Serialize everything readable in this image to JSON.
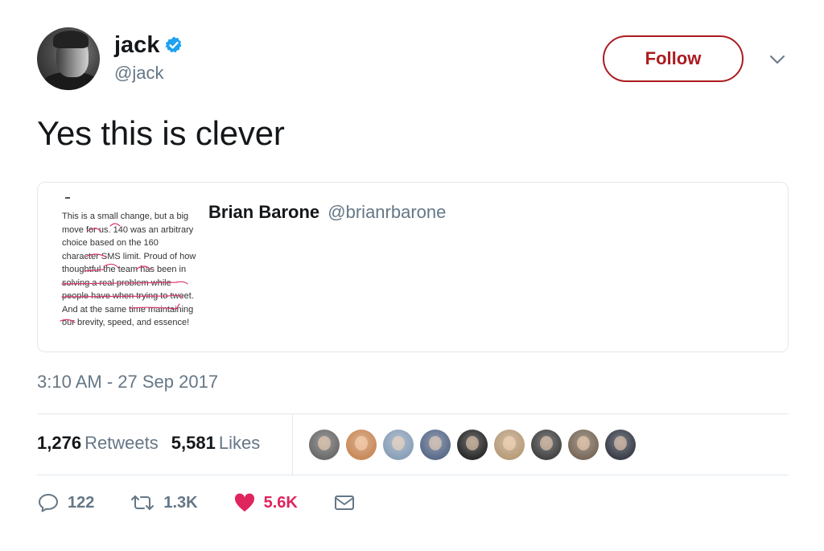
{
  "user": {
    "name": "jack",
    "handle": "@jack",
    "verified": true,
    "follow_label": "Follow"
  },
  "tweet": {
    "text": "Yes this is clever",
    "timestamp": "3:10 AM - 27 Sep 2017"
  },
  "quote": {
    "author_name": "Brian Barone",
    "author_handle": "@brianrbarone",
    "image_text": "This is a small change, but a big move for us. 140 was an arbitrary choice based on the 160 character SMS limit. Proud of how thoughtful the team has been in solving a real problem while people have when trying to tweet. And at the same time maintaining our brevity, speed, and essence!"
  },
  "stats": {
    "retweets_count": "1,276",
    "retweets_label": "Retweets",
    "likes_count": "5,581",
    "likes_label": "Likes"
  },
  "likers": [
    {
      "icon": "liker-avatar",
      "color": "#6b6b6b"
    },
    {
      "icon": "liker-avatar",
      "color": "#c98a5a"
    },
    {
      "icon": "liker-avatar",
      "color": "#8aa0b8"
    },
    {
      "icon": "liker-avatar",
      "color": "#5b6c8a"
    },
    {
      "icon": "liker-avatar",
      "color": "#2b2b2b"
    },
    {
      "icon": "liker-avatar",
      "color": "#b89d7a"
    },
    {
      "icon": "liker-avatar",
      "color": "#444444"
    },
    {
      "icon": "liker-avatar",
      "color": "#7a6a5a"
    },
    {
      "icon": "liker-avatar",
      "color": "#3a3f4a"
    }
  ],
  "actions": {
    "reply_count": "122",
    "retweet_count": "1.3K",
    "like_count": "5.6K"
  },
  "colors": {
    "follow_accent": "#ab1c20",
    "like_accent": "#e0245e",
    "secondary_text": "#657786",
    "verified": "#1da1f2"
  }
}
